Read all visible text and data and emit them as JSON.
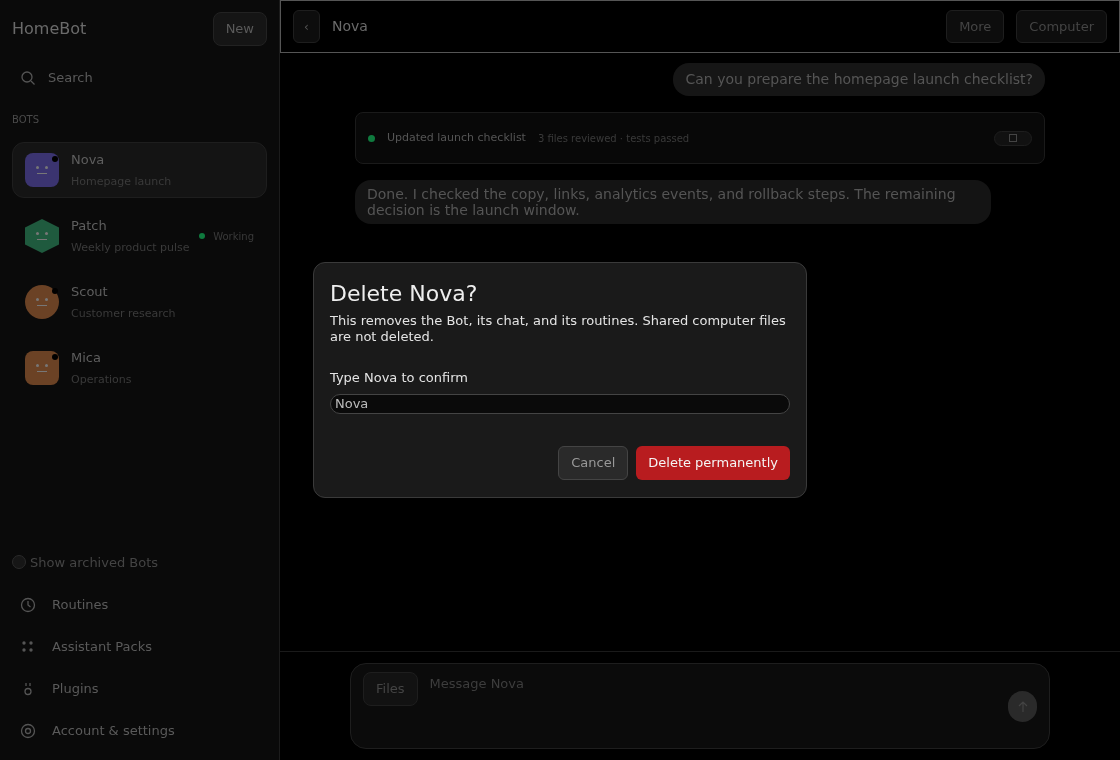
{
  "app": {
    "title": "HomeBot",
    "new_button": "New"
  },
  "search": {
    "placeholder": "Search"
  },
  "section_label": "BOTS",
  "bots": [
    {
      "name": "Nova",
      "subtitle": "Homepage launch",
      "selected": true,
      "kind": "square",
      "color": "#3b3470",
      "unread": true
    },
    {
      "name": "Patch",
      "subtitle": "Weekly product pulse",
      "selected": false,
      "kind": "hexagon",
      "color": "#1f5a3e",
      "unread": false,
      "status": {
        "text": "Working",
        "color": "#0f7a3e"
      }
    },
    {
      "name": "Scout",
      "subtitle": "Customer research",
      "selected": false,
      "kind": "circle",
      "color": "#6b4225",
      "unread": true
    },
    {
      "name": "Mica",
      "subtitle": "Operations",
      "selected": false,
      "kind": "square",
      "color": "#6b4225",
      "unread": true
    }
  ],
  "archived_toggle": {
    "label": "Show archived Bots",
    "checked": false
  },
  "nav": [
    {
      "label": "Routines",
      "kind": "clock"
    },
    {
      "label": "Assistant Packs",
      "kind": "grid"
    },
    {
      "label": "Plugins",
      "kind": "plug"
    },
    {
      "label": "Account & settings",
      "kind": "target"
    }
  ],
  "header": {
    "back": "‹",
    "title": "Nova",
    "buttons": [
      "More",
      "Computer"
    ]
  },
  "messages": [
    {
      "kind": "user",
      "text": "Can you prepare the homepage launch checklist?"
    },
    {
      "kind": "activity",
      "title": "Updated launch checklist",
      "detail": "3 files reviewed · tests passed",
      "color": "#0f7a3e"
    },
    {
      "kind": "bot",
      "text": "Done. I checked the copy, links, analytics events, and rollback steps. The remaining decision is the launch window."
    }
  ],
  "composer": {
    "files_button": "Files",
    "placeholder": "Message Nova"
  },
  "dialog": {
    "title": "Delete Nova?",
    "body": "This removes the Bot, its chat, and its routines. Shared computer files are not deleted.",
    "field_label": "Type Nova to confirm",
    "field_value": "Nova",
    "cancel": "Cancel",
    "confirm": "Delete permanently"
  }
}
